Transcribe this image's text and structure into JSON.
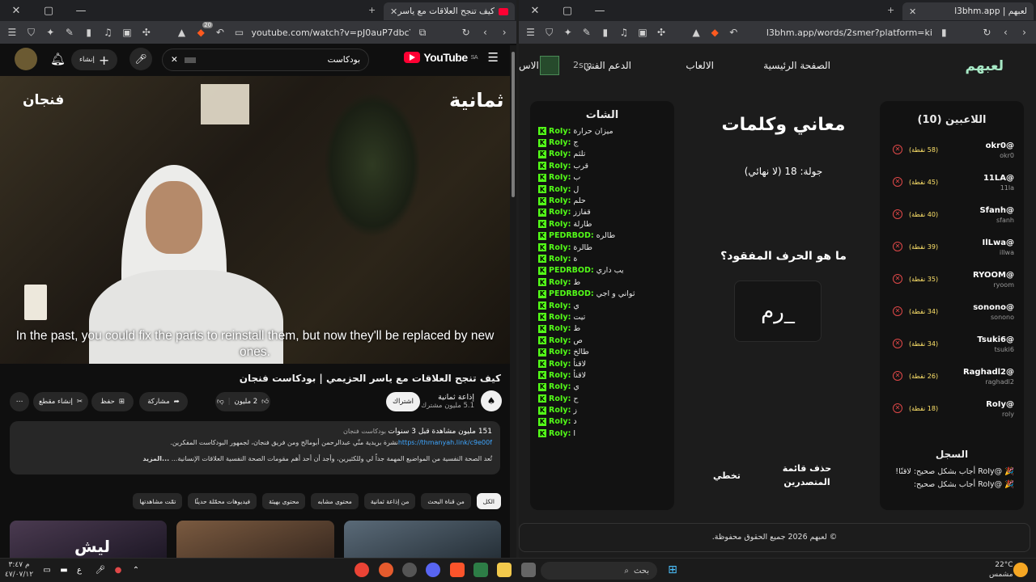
{
  "left_window": {
    "tab_title": "كيف تنجح العلاقات مع ياسر الحز...",
    "url": "youtube.com/watch?v=pJ0auP7dbcY&t=4...",
    "ext_badge": "20",
    "youtube": {
      "logo": "YouTube",
      "region": "SA",
      "search_value": "بودكاست",
      "create_label": "إنشاء",
      "video": {
        "brand_left": "فنجان",
        "brand_right": "ثمانية",
        "subtitle": "In the past, you could fix the parts to reinstall them, but now they'll be replaced by new ones.",
        "title": "كيف تنجح العلاقات مع ياسر الحزيمي | بودكاست فنجان",
        "channel": "إذاعة ثمانية",
        "subscribers": "5.1 مليون مشترك",
        "subscribe": "اشتراك",
        "likes": "2 مليون",
        "share": "مشاركة",
        "save": "حفظ",
        "clip": "إنشاء مقطع",
        "more": "⋯"
      },
      "description": {
        "meta": "151 مليون مشاهدة قبل 3 سنوات",
        "tag": "بودكاست فنجان",
        "line1": "نشرة بريدية منّي عبدالرحمن أبومالح ومن فريق فنجان، لجمهور البودكاست المفكرين.",
        "link": "https://thmanyah.link/c9e00f",
        "line2": "تُعد الصحة النفسية من المواضيع المهمة جداً لي وللكثيرين، وأجد أن أحد أهم مقومات الصحة النفسية العلاقات الإنسانية...",
        "more": "...المزيد"
      },
      "chips": [
        "الكل",
        "من قناة البحث",
        "من إذاعة ثمانية",
        "محتوى مشابه",
        "محتوى بهيئة",
        "فيديوهات محمّلة حديثًا",
        "تمّت مشاهدتها"
      ],
      "thumb_text": "ليش"
    }
  },
  "right_window": {
    "tab_title": "لعبهم | l3bhm.app",
    "url": "l3bhm.app/words/2smer?platform=kick",
    "site": {
      "logo": "لعبهم",
      "nav": [
        "الصفحة الرئيسية",
        "الالعاب",
        "الدعم الفني"
      ],
      "nav_partial": "الاس",
      "user_tag": "2sm"
    },
    "players": {
      "header": "اللاعبين (10)",
      "list": [
        {
          "name": "@okr0",
          "sub": "okr0",
          "points": "(58 نقطة)"
        },
        {
          "name": "@11LA",
          "sub": "11la",
          "points": "(45 نقطة)"
        },
        {
          "name": "@Sfanh",
          "sub": "sfanh",
          "points": "(40 نقطة)"
        },
        {
          "name": "@IlLwa",
          "sub": "illwa",
          "points": "(39 نقطة)"
        },
        {
          "name": "@RYOOM",
          "sub": "ryoom",
          "points": "(35 نقطة)"
        },
        {
          "name": "@sonono",
          "sub": "sonono",
          "points": "(34 نقطة)"
        },
        {
          "name": "@Tsuki6",
          "sub": "tsuki6",
          "points": "(34 نقطة)"
        },
        {
          "name": "@Raghadl2",
          "sub": "raghadl2",
          "points": "(26 نقطة)"
        },
        {
          "name": "@RoIy",
          "sub": "roly",
          "points": "(18 نقطة)"
        }
      ],
      "log_header": "السجل",
      "log": [
        "🎉 @RoIy أجاب بشكل صحيح: لاقنًا!",
        "🎉 @RoIy أجاب بشكل صحيح:"
      ]
    },
    "game": {
      "title": "معاني وكلمات",
      "round": "جولة: 18 (لا نهائي)",
      "question": "ما هو الحرف المفقود؟",
      "puzzle": "رم_",
      "btn_skip": "تخطي",
      "btn_clear": "حذف قائمة المتصدرين"
    },
    "chat": {
      "header": "الشات",
      "lines": [
        {
          "user": "RoIy:",
          "msg": "ميزان حرارة"
        },
        {
          "user": "RoIy:",
          "msg": "ج"
        },
        {
          "user": "RoIy:",
          "msg": "تلثم"
        },
        {
          "user": "RoIy:",
          "msg": "قرب"
        },
        {
          "user": "RoIy:",
          "msg": "ب"
        },
        {
          "user": "RoIy:",
          "msg": "ل"
        },
        {
          "user": "RoIy:",
          "msg": "حلم"
        },
        {
          "user": "RoIy:",
          "msg": "قفازز"
        },
        {
          "user": "RoIy:",
          "msg": "طارلة"
        },
        {
          "user": "PEDRBOD:",
          "msg": "طالره"
        },
        {
          "user": "RoIy:",
          "msg": "طالرة"
        },
        {
          "user": "RoIy:",
          "msg": "ة"
        },
        {
          "user": "PEDRBOD:",
          "msg": "يب داري"
        },
        {
          "user": "RoIy:",
          "msg": "ط"
        },
        {
          "user": "PEDRBOD:",
          "msg": "ثواني و اجي"
        },
        {
          "user": "RoIy:",
          "msg": "ي"
        },
        {
          "user": "RoIy:",
          "msg": "تيت"
        },
        {
          "user": "RoIy:",
          "msg": "ط"
        },
        {
          "user": "RoIy:",
          "msg": "ص"
        },
        {
          "user": "RoIy:",
          "msg": "طالخ"
        },
        {
          "user": "RoIy:",
          "msg": "لاقنأ"
        },
        {
          "user": "RoIy:",
          "msg": "لاقنأ"
        },
        {
          "user": "RoIy:",
          "msg": "ي"
        },
        {
          "user": "RoIy:",
          "msg": "ح"
        },
        {
          "user": "RoIy:",
          "msg": "ز"
        },
        {
          "user": "RoIy:",
          "msg": "د"
        },
        {
          "user": "RoIy:",
          "msg": "ا"
        }
      ]
    },
    "footer": "© لعبهم 2026 جميع الحقوق محفوظة."
  },
  "taskbar": {
    "search": "بحث",
    "weather_temp": "22°C",
    "weather_text": "مشمس",
    "time": "م ٣:٤٧",
    "date": "٤٧/٠٧/١٢",
    "lang": "ع"
  },
  "colors": {
    "youtube_red": "#ff0033",
    "kick_green": "#53fc18",
    "site_logo": "#a7e8c5"
  }
}
